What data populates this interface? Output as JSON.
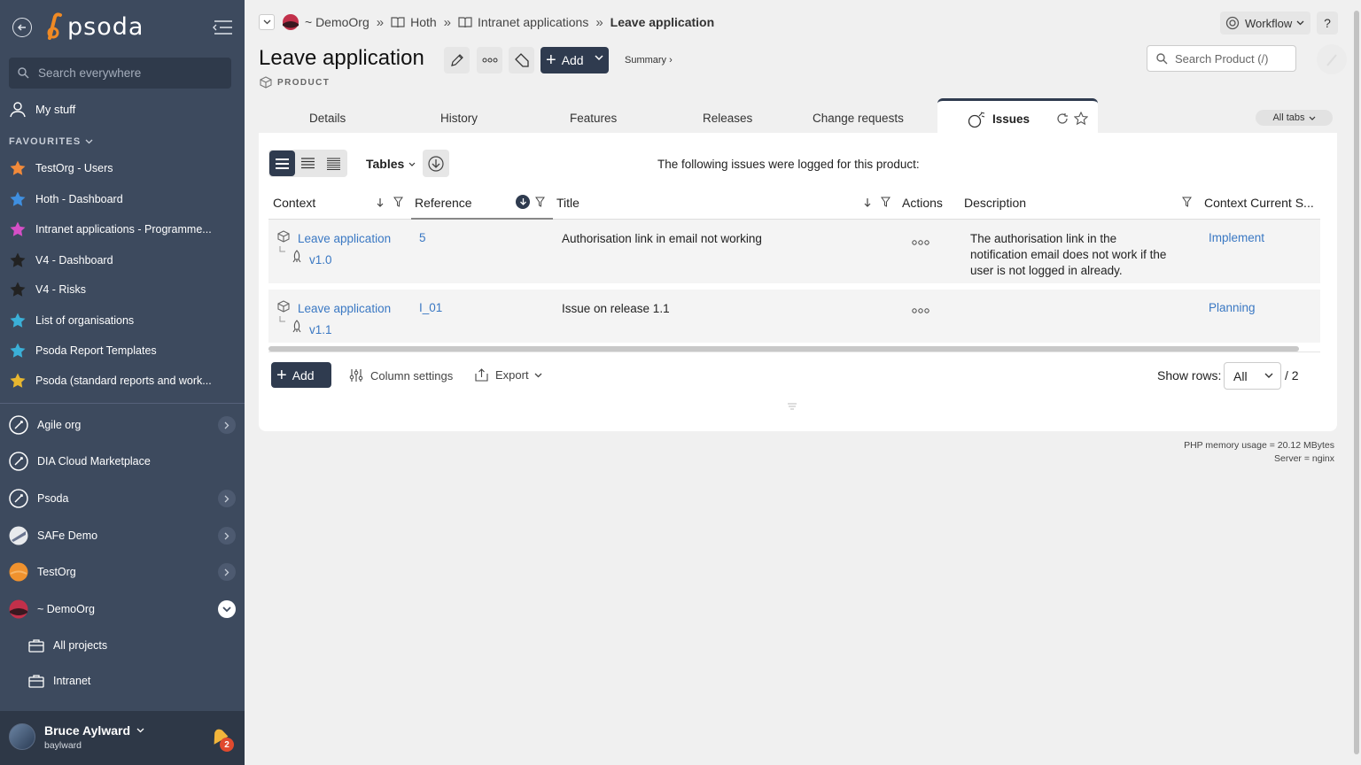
{
  "sidebar": {
    "logo_text": "psoda",
    "search_placeholder": "Search everywhere",
    "my_stuff": "My stuff",
    "favourites_heading": "FAVOURITES",
    "favourites": [
      {
        "label": "TestOrg - Users",
        "color": "#f28a3a"
      },
      {
        "label": "Hoth - Dashboard",
        "color": "#3f8fe0"
      },
      {
        "label": "Intranet applications - Programme...",
        "color": "#d64fc7"
      },
      {
        "label": "V4 - Dashboard",
        "color": "#222222"
      },
      {
        "label": "V4 - Risks",
        "color": "#222222"
      },
      {
        "label": "List of organisations",
        "color": "#3bb0d8"
      },
      {
        "label": "Psoda Report Templates",
        "color": "#3bb0d8"
      },
      {
        "label": "Psoda (standard reports and work...",
        "color": "#e8b730"
      }
    ],
    "orgs": [
      {
        "label": "Agile org",
        "expandable": true
      },
      {
        "label": "DIA Cloud Marketplace",
        "expandable": false
      },
      {
        "label": "Psoda",
        "expandable": true
      },
      {
        "label": "SAFe Demo",
        "expandable": true
      },
      {
        "label": "TestOrg",
        "expandable": true
      },
      {
        "label": "~ DemoOrg",
        "expandable": true
      }
    ],
    "sub_items": [
      "All projects",
      "Intranet"
    ],
    "user": {
      "name": "Bruce Aylward",
      "login": "baylward",
      "notifications": "2"
    }
  },
  "breadcrumb": {
    "org": "~ DemoOrg",
    "items": [
      "Hoth",
      "Intranet applications"
    ],
    "current": "Leave application"
  },
  "header": {
    "title": "Leave application",
    "type": "PRODUCT",
    "add_label": "Add",
    "summary_label": "Summary ›",
    "workflow_label": "Workflow",
    "help_label": "?",
    "search_placeholder": "Search Product (/)"
  },
  "tabs": {
    "items": [
      "Details",
      "History",
      "Features",
      "Releases",
      "Change requests"
    ],
    "active": "Issues",
    "all_tabs": "All tabs"
  },
  "panel": {
    "tables_label": "Tables",
    "intro": "The following issues were logged for this product:",
    "columns": [
      "Context",
      "Reference",
      "Title",
      "Actions",
      "Description",
      "Context Current S..."
    ],
    "rows": [
      {
        "context": "Leave application",
        "release": "v1.0",
        "reference": "5",
        "title": "Authorisation link in email not working",
        "description": [
          "The authorisation link in the",
          "notification email does not work if the",
          "user is not logged in already."
        ],
        "status": "Implement"
      },
      {
        "context": "Leave application",
        "release": "v1.1",
        "reference": "I_01",
        "title": "Issue on release 1.1",
        "description": [],
        "status": "Planning"
      }
    ],
    "add_label": "Add",
    "column_settings": "Column settings",
    "export": "Export",
    "show_rows_label": "Show rows:",
    "show_rows_value": "All",
    "total": "/ 2"
  },
  "footer": {
    "memory": "PHP memory usage = 20.12 MBytes",
    "server": "Server = nginx"
  },
  "colors": {
    "sidebar": "#3d4a5e",
    "primary": "#2f3b4f",
    "link": "#3a78c3"
  }
}
